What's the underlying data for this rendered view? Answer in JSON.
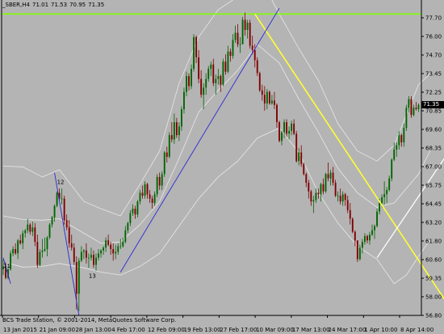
{
  "header": {
    "symbol": "_SBER,H4",
    "open": "71.01",
    "high": "71.53",
    "low": "70.95",
    "close": "71.35"
  },
  "footer": {
    "copyright": "BCS Trade Station, © 2001-2014, MetaQuotes Software Corp."
  },
  "price_badge": "71.35",
  "price_axis": {
    "ticks": [
      "77.70",
      "76.00",
      "74.70",
      "73.45",
      "72.25",
      "70.85",
      "69.60",
      "68.35",
      "67.00",
      "65.75",
      "64.45",
      "63.20",
      "61.80",
      "60.60",
      "59.35",
      "58.00",
      "56.80"
    ]
  },
  "time_axis": {
    "ticks": [
      "13 Jan 2015",
      "21 Jan 09:00",
      "28 Jan 13:00",
      "4 Feb 17:00",
      "12 Feb 09:00",
      "19 Feb 13:00",
      "27 Feb 17:00",
      "10 Mar 09:00",
      "17 Mar 13:00",
      "24 Mar 17:00",
      "1 Apr 10:00",
      "8 Apr 14:00"
    ]
  },
  "colors": {
    "background": "#b4b4b4",
    "bull": "#006400",
    "bear": "#800000",
    "bands": "#e8e8e8",
    "hline": "#7fff00",
    "yellow_trend": "#ffff33",
    "blue_trend": "#2a2ad4",
    "white_trend": "#ffffff"
  },
  "chart_data": {
    "type": "candlestick",
    "timeframe": "H4",
    "ylim": [
      56.8,
      78.0
    ],
    "horizontal_line": 77.7,
    "last_price": 71.35,
    "candles": [
      [
        60,
        60.7,
        59.6,
        60.2
      ],
      [
        60.2,
        60.5,
        59.3,
        59.4
      ],
      [
        59.4,
        60.1,
        59.3,
        60
      ],
      [
        60,
        61.3,
        59.9,
        61.1
      ],
      [
        61.1,
        61.6,
        60.9,
        61.4
      ],
      [
        61.4,
        61.8,
        61,
        61.1
      ],
      [
        61.1,
        62.1,
        60.7,
        62
      ],
      [
        62,
        62.4,
        61.7,
        61.8
      ],
      [
        61.8,
        62.7,
        61.4,
        62.5
      ],
      [
        62.5,
        62.8,
        62.2,
        62.7
      ],
      [
        62.7,
        63.5,
        62.5,
        63.1
      ],
      [
        63.1,
        63.2,
        62.4,
        62.6
      ],
      [
        62.6,
        63.3,
        62.3,
        62.9
      ],
      [
        62.9,
        63.2,
        61.6,
        61.9
      ],
      [
        61.9,
        62.4,
        60.1,
        60.3
      ],
      [
        60.3,
        61.4,
        60.2,
        61.2
      ],
      [
        61.2,
        62.1,
        60.8,
        61.3
      ],
      [
        61.3,
        62.2,
        61.2,
        61.4
      ],
      [
        61.4,
        62.3,
        60.9,
        62.2
      ],
      [
        62.2,
        63.2,
        62.1,
        63.1
      ],
      [
        63.1,
        63.7,
        62.9,
        63.6
      ],
      [
        63.6,
        64.5,
        63.3,
        64.4
      ],
      [
        64.4,
        65.4,
        64.3,
        65.3
      ],
      [
        65.3,
        65.6,
        64.8,
        64.9
      ],
      [
        64.9,
        65.6,
        64.5,
        64.9
      ],
      [
        64.9,
        65.1,
        63.1,
        63.4
      ],
      [
        63.4,
        63.8,
        62.7,
        62.9
      ],
      [
        62.9,
        63.4,
        61.5,
        61.8
      ],
      [
        61.8,
        62.4,
        61.3,
        61.5
      ],
      [
        61.5,
        61.8,
        60.3,
        60.5
      ],
      [
        60.5,
        60.9,
        57.2,
        58.3
      ],
      [
        58.3,
        60.8,
        57.1,
        60.6
      ],
      [
        60.6,
        61.6,
        60.5,
        61.2
      ],
      [
        61.2,
        61.4,
        60.7,
        61.3
      ],
      [
        61.3,
        61.8,
        60.4,
        60.8
      ],
      [
        60.8,
        61.1,
        60.1,
        60.8
      ],
      [
        60.8,
        61.5,
        60.6,
        61
      ],
      [
        61,
        61.3,
        60.1,
        60.3
      ],
      [
        60.3,
        61.1,
        59.9,
        60.8
      ],
      [
        60.8,
        61.4,
        60.6,
        61.1
      ],
      [
        61.1,
        61.4,
        60.8,
        61.3
      ],
      [
        61.3,
        61.6,
        61,
        61.5
      ],
      [
        61.5,
        62.2,
        61.2,
        62
      ],
      [
        62,
        62.4,
        61.6,
        61.7
      ],
      [
        61.7,
        61.9,
        61,
        61.4
      ],
      [
        61.4,
        61.8,
        60.6,
        61.1
      ],
      [
        61.1,
        61.7,
        60.7,
        61.2
      ],
      [
        61.2,
        61.8,
        61,
        61.6
      ],
      [
        61.6,
        62.1,
        61.4,
        61.6
      ],
      [
        61.6,
        62.2,
        61.5,
        61.9
      ],
      [
        61.9,
        63,
        61.8,
        62.7
      ],
      [
        62.7,
        63.3,
        62.5,
        63.2
      ],
      [
        63.2,
        64.1,
        63,
        63.9
      ],
      [
        63.9,
        64.5,
        63.7,
        64.2
      ],
      [
        64.2,
        64.4,
        63.5,
        63.8
      ],
      [
        63.8,
        64.8,
        63.6,
        64.7
      ],
      [
        64.7,
        65.5,
        64.5,
        65.3
      ],
      [
        65.3,
        65.8,
        64.9,
        65.1
      ],
      [
        65.1,
        66.1,
        64.9,
        65.9
      ],
      [
        65.9,
        66,
        64.9,
        65.2
      ],
      [
        65.2,
        65.5,
        64.6,
        64.9
      ],
      [
        64.9,
        65.1,
        64.2,
        64.6
      ],
      [
        64.6,
        65.4,
        64.4,
        65.2
      ],
      [
        65.2,
        66.6,
        65,
        66.4
      ],
      [
        66.4,
        66.7,
        65.5,
        65.8
      ],
      [
        65.8,
        66.8,
        65.5,
        66.6
      ],
      [
        66.6,
        68.2,
        66.4,
        68.1
      ],
      [
        68.1,
        68.5,
        67.4,
        67.8
      ],
      [
        67.8,
        69.5,
        67.7,
        69.3
      ],
      [
        69.3,
        70.2,
        68.8,
        69
      ],
      [
        69,
        70.8,
        68.7,
        70.2
      ],
      [
        70.2,
        70.5,
        69.1,
        69.3
      ],
      [
        69.3,
        70.2,
        68.9,
        69.9
      ],
      [
        69.9,
        71.3,
        69.6,
        71.1
      ],
      [
        71.1,
        72.6,
        70.8,
        72.3
      ],
      [
        72.3,
        73.7,
        72,
        73.4
      ],
      [
        73.4,
        73.6,
        72.4,
        72.7
      ],
      [
        72.7,
        74.2,
        72.5,
        73.9
      ],
      [
        73.9,
        76.3,
        73.7,
        76.1
      ],
      [
        76.1,
        76.2,
        74.3,
        74.7
      ],
      [
        74.7,
        75.2,
        72.9,
        73.2
      ],
      [
        73.2,
        73.8,
        71.9,
        72.1
      ],
      [
        72.1,
        72.9,
        71.1,
        72.6
      ],
      [
        72.6,
        73.6,
        72.1,
        73.2
      ],
      [
        73.2,
        74.1,
        73,
        73.9
      ],
      [
        73.9,
        74.4,
        73.4,
        74.2
      ],
      [
        74.2,
        74.6,
        72.7,
        72.9
      ],
      [
        72.9,
        73.5,
        72.1,
        73.2
      ],
      [
        73.2,
        73.9,
        72.8,
        73.4
      ],
      [
        73.4,
        73.5,
        72.3,
        72.8
      ],
      [
        72.8,
        74.6,
        72.7,
        74.4
      ],
      [
        74.4,
        74.9,
        73.5,
        73.7
      ],
      [
        73.7,
        75.5,
        73.6,
        75.1
      ],
      [
        75.1,
        75.3,
        74.4,
        74.8
      ],
      [
        74.8,
        76.3,
        74.6,
        75.9
      ],
      [
        75.9,
        76.9,
        75.7,
        76.4
      ],
      [
        76.4,
        77,
        75.4,
        75.6
      ],
      [
        75.6,
        76.1,
        75,
        75.6
      ],
      [
        75.6,
        77.5,
        75.6,
        77.3
      ],
      [
        77.3,
        77.8,
        76.2,
        76.6
      ],
      [
        76.6,
        77.3,
        76,
        77.1
      ],
      [
        77.1,
        77.3,
        75.3,
        75.5
      ],
      [
        75.5,
        76.2,
        74.9,
        75.2
      ],
      [
        75.2,
        75.6,
        74,
        74.5
      ],
      [
        74.5,
        74.7,
        73.4,
        73.6
      ],
      [
        73.6,
        73.7,
        72.3,
        72.4
      ],
      [
        72.4,
        72.8,
        71.7,
        72.1
      ],
      [
        72.1,
        72.7,
        71,
        71.5
      ],
      [
        71.5,
        72.5,
        71.1,
        72.3
      ],
      [
        72.3,
        72.4,
        71.4,
        71.5
      ],
      [
        71.5,
        72.1,
        71.4,
        71.7
      ],
      [
        71.7,
        72.3,
        71.1,
        71.4
      ],
      [
        71.4,
        71.5,
        69.8,
        70.2
      ],
      [
        70.2,
        70.3,
        68.8,
        68.9
      ],
      [
        68.9,
        69.6,
        68.6,
        69.5
      ],
      [
        69.5,
        70.4,
        69.1,
        70.2
      ],
      [
        70.2,
        70.4,
        69.2,
        69.4
      ],
      [
        69.4,
        69.9,
        69,
        69.6
      ],
      [
        69.6,
        70.3,
        69.3,
        70.1
      ],
      [
        70.1,
        70.4,
        69.3,
        69.4
      ],
      [
        69.4,
        69.6,
        67.4,
        67.5
      ],
      [
        67.5,
        68.4,
        67.2,
        68.1
      ],
      [
        68.1,
        68.6,
        67.1,
        67.3
      ],
      [
        67.3,
        67.4,
        66.5,
        66.6
      ],
      [
        66.6,
        66.7,
        65.7,
        66
      ],
      [
        66,
        66.2,
        64.9,
        65.4
      ],
      [
        65.4,
        65.5,
        64.4,
        64.7
      ],
      [
        64.7,
        65.1,
        63.9,
        64.8
      ],
      [
        64.8,
        65.6,
        64.6,
        65.3
      ],
      [
        65.3,
        65.6,
        64.9,
        65.2
      ],
      [
        65.2,
        66,
        64.7,
        65.9
      ],
      [
        65.9,
        66.3,
        65.2,
        65.4
      ],
      [
        65.4,
        66.7,
        65.3,
        66.6
      ],
      [
        66.6,
        67.4,
        66.1,
        66.3
      ],
      [
        66.3,
        66.9,
        65.8,
        66.7
      ],
      [
        66.7,
        67.1,
        65.8,
        66
      ],
      [
        66,
        66.2,
        65,
        65.1
      ],
      [
        65.1,
        65.4,
        64.7,
        65.1
      ],
      [
        65.1,
        65.6,
        64.5,
        64.7
      ],
      [
        64.7,
        65.4,
        64.4,
        65.2
      ],
      [
        65.2,
        65.3,
        64.4,
        64.8
      ],
      [
        64.8,
        65.1,
        63.9,
        64.1
      ],
      [
        64.1,
        64.6,
        63.1,
        63.5
      ],
      [
        63.5,
        63.6,
        62.5,
        62.6
      ],
      [
        62.6,
        62.7,
        61.6,
        62
      ],
      [
        62,
        62,
        60.5,
        60.7
      ],
      [
        60.7,
        61.7,
        60.6,
        61.5
      ],
      [
        61.5,
        62.1,
        61.1,
        61.9
      ],
      [
        61.9,
        62.5,
        61.7,
        62.3
      ],
      [
        62.3,
        62.4,
        61.8,
        62
      ],
      [
        62,
        62.6,
        61.7,
        62.4
      ],
      [
        62.4,
        63.1,
        62.3,
        62.7
      ],
      [
        62.7,
        63.1,
        62.1,
        63
      ],
      [
        63,
        64.2,
        62.9,
        64
      ],
      [
        64,
        64.9,
        63.8,
        64.6
      ],
      [
        64.6,
        65.2,
        64.3,
        65
      ],
      [
        65,
        66.1,
        64.5,
        65.2
      ],
      [
        65.2,
        65.7,
        64.6,
        65.5
      ],
      [
        65.5,
        66.5,
        65.4,
        66.3
      ],
      [
        66.3,
        67.7,
        66.1,
        67.6
      ],
      [
        67.6,
        68.8,
        67.5,
        68.3
      ],
      [
        68.3,
        68.8,
        67.8,
        68.6
      ],
      [
        68.6,
        69.6,
        68.3,
        69.3
      ],
      [
        69.3,
        69.4,
        68.5,
        68.8
      ],
      [
        68.8,
        70.1,
        68.5,
        69.8
      ],
      [
        69.8,
        71.4,
        69.6,
        71.2
      ],
      [
        71.2,
        72,
        70.9,
        71.8
      ],
      [
        71.8,
        72,
        70.5,
        70.7
      ],
      [
        70.7,
        71.4,
        70.6,
        71.2
      ],
      [
        71.2,
        71.6,
        71,
        71.1
      ],
      [
        71.1,
        71.5,
        70.9,
        71.4
      ]
    ],
    "bands": {
      "upper": [
        [
          0,
          67.15
        ],
        [
          8,
          67.1
        ],
        [
          16,
          66.4
        ],
        [
          23,
          66.9
        ],
        [
          33,
          64.7
        ],
        [
          40,
          64.2
        ],
        [
          48,
          63.7
        ],
        [
          56,
          65.9
        ],
        [
          64,
          68.2
        ],
        [
          72,
          72.9
        ],
        [
          80,
          76.1
        ],
        [
          88,
          78
        ],
        [
          96,
          78.9
        ],
        [
          104,
          79.6
        ],
        [
          108,
          79.3
        ],
        [
          113,
          77.7
        ],
        [
          121,
          75.3
        ],
        [
          129,
          73.1
        ],
        [
          137,
          70.1
        ],
        [
          145,
          68.2
        ],
        [
          153,
          67.5
        ],
        [
          160,
          68.6
        ],
        [
          170,
          72.8
        ],
        [
          175,
          73.6
        ]
      ],
      "middle": [
        [
          0,
          63.7
        ],
        [
          8,
          63.45
        ],
        [
          16,
          63.4
        ],
        [
          23,
          63.5
        ],
        [
          33,
          62.5
        ],
        [
          40,
          61.8
        ],
        [
          48,
          61.9
        ],
        [
          56,
          63.1
        ],
        [
          64,
          64.7
        ],
        [
          72,
          67.7
        ],
        [
          80,
          70.9
        ],
        [
          88,
          72.4
        ],
        [
          96,
          73.8
        ],
        [
          104,
          75.6
        ],
        [
          113,
          74.3
        ],
        [
          121,
          71.8
        ],
        [
          129,
          69.5
        ],
        [
          137,
          67
        ],
        [
          145,
          65.3
        ],
        [
          153,
          64.3
        ],
        [
          160,
          64.6
        ],
        [
          170,
          66.6
        ],
        [
          175,
          68.3
        ]
      ],
      "lower": [
        [
          0,
          60.5
        ],
        [
          8,
          60.15
        ],
        [
          16,
          60.2
        ],
        [
          23,
          60.4
        ],
        [
          33,
          60.1
        ],
        [
          40,
          59.8
        ],
        [
          48,
          59.6
        ],
        [
          56,
          60.2
        ],
        [
          64,
          61.1
        ],
        [
          72,
          63
        ],
        [
          80,
          64.9
        ],
        [
          88,
          66.4
        ],
        [
          96,
          67.5
        ],
        [
          104,
          69.1
        ],
        [
          113,
          69.8
        ],
        [
          121,
          68.1
        ],
        [
          129,
          65.3
        ],
        [
          137,
          63.2
        ],
        [
          145,
          61.6
        ],
        [
          153,
          60.7
        ],
        [
          160,
          59
        ],
        [
          165,
          59.6
        ],
        [
          170,
          60.9
        ],
        [
          175,
          62.1
        ]
      ]
    },
    "trendlines": [
      {
        "color": "yellow",
        "from": [
          103,
          77.7
        ],
        "to": [
          185,
          56.8
        ]
      },
      {
        "color": "blue",
        "from": [
          48,
          59.8
        ],
        "to": [
          113,
          78.1
        ]
      },
      {
        "color": "blue",
        "from": [
          21,
          66.7
        ],
        "to": [
          31,
          56.8
        ]
      },
      {
        "color": "blue",
        "from": [
          0,
          60.8
        ],
        "to": [
          3,
          59
        ]
      },
      {
        "color": "white",
        "from": [
          153,
          60.8
        ],
        "to": [
          187,
          69.3
        ]
      }
    ],
    "annotations": [
      {
        "text": "12",
        "at": [
          22,
          65.9
        ]
      },
      {
        "text": "13",
        "at": [
          35,
          59.4
        ]
      },
      {
        "text": "11",
        "at": [
          0,
          60.1
        ]
      }
    ]
  }
}
